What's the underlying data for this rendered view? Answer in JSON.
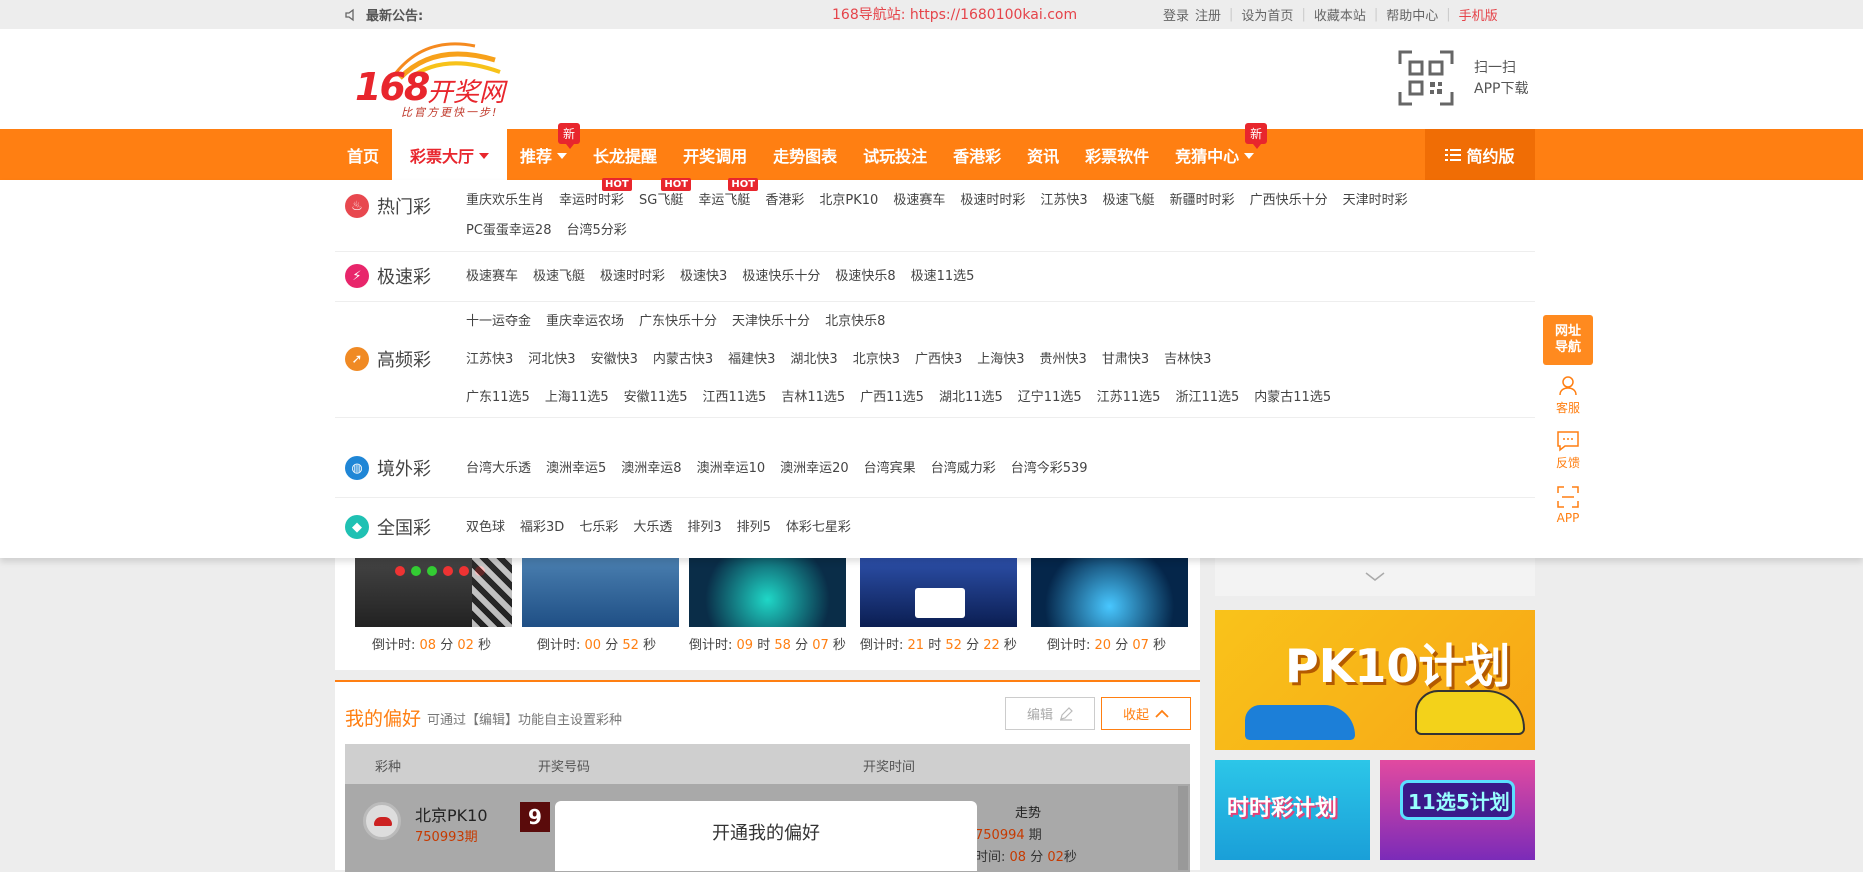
{
  "topbar": {
    "notice_label": "最新公告:",
    "site_url": "168导航站: https://1680100kai.com",
    "links": [
      "登录",
      "注册",
      "设为首页",
      "收藏本站",
      "帮助中心"
    ],
    "mobile": "手机版"
  },
  "header": {
    "logo_num": "168",
    "logo_text": "开奖网",
    "logo_slogan": "比官方更快一步!",
    "scan_line1": "扫一扫",
    "scan_line2": "APP下载"
  },
  "nav": {
    "items": [
      {
        "label": "首页"
      },
      {
        "label": "彩票大厅",
        "active": true,
        "caret": true
      },
      {
        "label": "推荐",
        "caret": true,
        "badge": "新"
      },
      {
        "label": "长龙提醒"
      },
      {
        "label": "开奖调用"
      },
      {
        "label": "走势图表"
      },
      {
        "label": "试玩投注"
      },
      {
        "label": "香港彩"
      },
      {
        "label": "资讯"
      },
      {
        "label": "彩票软件"
      },
      {
        "label": "竞猜中心",
        "caret": true,
        "badge": "新"
      }
    ],
    "simple_label": "简约版"
  },
  "dropdown": {
    "rows": [
      {
        "category": "热门彩",
        "color": "#e8484f",
        "games": [
          "重庆欢乐生肖",
          "幸运时时彩",
          "SG飞艇",
          "幸运飞艇",
          "香港彩",
          "北京PK10",
          "极速赛车",
          "极速时时彩",
          "江苏快3",
          "极速飞艇",
          "新疆时时彩",
          "广西快乐十分",
          "天津时时彩",
          "PC蛋蛋幸运28",
          "台湾5分彩"
        ],
        "hot": [
          1,
          2,
          3
        ]
      },
      {
        "category": "极速彩",
        "color": "#e8266b",
        "games": [
          "极速赛车",
          "极速飞艇",
          "极速时时彩",
          "极速快3",
          "极速快乐十分",
          "极速快乐8",
          "极速11选5"
        ],
        "hot": []
      },
      {
        "category": "高频彩",
        "color": "#f08a24",
        "games": [
          "十一运夺金",
          "重庆幸运农场",
          "广东快乐十分",
          "天津快乐十分",
          "北京快乐8",
          "江苏快3",
          "河北快3",
          "安徽快3",
          "内蒙古快3",
          "福建快3",
          "湖北快3",
          "北京快3",
          "广西快3",
          "上海快3",
          "贵州快3",
          "甘肃快3",
          "吉林快3",
          "广东11选5",
          "上海11选5",
          "安徽11选5",
          "江西11选5",
          "吉林11选5",
          "广西11选5",
          "湖北11选5",
          "辽宁11选5",
          "江苏11选5",
          "浙江11选5",
          "内蒙古11选5"
        ],
        "hot": []
      },
      {
        "category": "境外彩",
        "color": "#1f86d6",
        "games": [
          "台湾大乐透",
          "澳洲幸运5",
          "澳洲幸运8",
          "澳洲幸运10",
          "澳洲幸运20",
          "台湾宾果",
          "台湾威力彩",
          "台湾今彩539"
        ],
        "hot": []
      },
      {
        "category": "全国彩",
        "color": "#1fc1b3",
        "games": [
          "双色球",
          "福彩3D",
          "七乐彩",
          "大乐透",
          "排列3",
          "排列5",
          "体彩七星彩"
        ],
        "hot": []
      }
    ],
    "hot_label": "HOT"
  },
  "side": {
    "nav_label": "网址导航",
    "service": "客服",
    "feedback": "反馈",
    "app": "APP"
  },
  "countdowns": [
    {
      "label": "倒计时:",
      "h": null,
      "m": "08",
      "s": "02"
    },
    {
      "label": "倒计时:",
      "h": null,
      "m": "00",
      "s": "52"
    },
    {
      "label": "倒计时:",
      "h": "09",
      "m": "58",
      "s": "07"
    },
    {
      "label": "倒计时:",
      "h": "21",
      "m": "52",
      "s": "22"
    },
    {
      "label": "倒计时:",
      "h": null,
      "m": "20",
      "s": "07"
    }
  ],
  "units": {
    "h": "时",
    "m": "分",
    "s": "秒"
  },
  "preference": {
    "title": "我的偏好",
    "hint": "可通过【编辑】功能自主设置彩种",
    "edit": "编辑",
    "fold": "收起",
    "col_game": "彩种",
    "col_number": "开奖号码",
    "col_time": "开奖时间",
    "row_name": "北京PK10",
    "row_issue": "750993期",
    "row_ball": "9",
    "row_trend": "走势",
    "row_next": "750994",
    "row_next_unit": "期",
    "row_time_label": "时间:",
    "row_time_m": "08",
    "row_time_unit_m": "分",
    "row_time_s": "02",
    "row_time_unit_s": "秒"
  },
  "modal": {
    "title": "开通我的偏好"
  },
  "ads": {
    "big": "PK10计划",
    "s1": "时时彩计划",
    "s2": "11选5计划"
  }
}
